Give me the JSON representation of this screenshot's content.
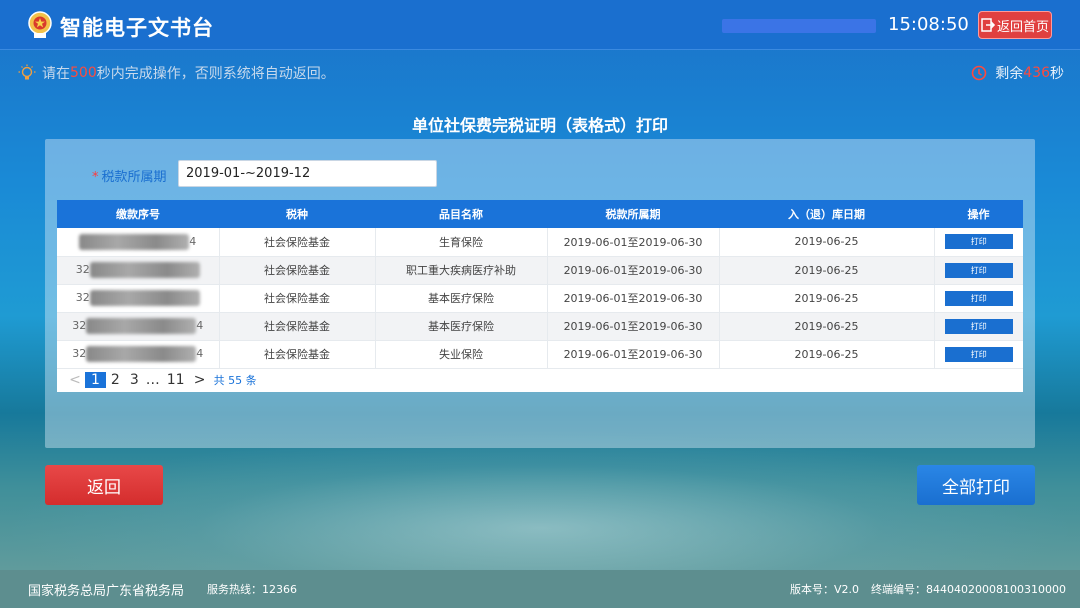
{
  "header": {
    "app_title": "智能电子文书台",
    "clock": "15:08:50",
    "home_button": "返回首页"
  },
  "notice": {
    "pre": "请在",
    "seconds": "500",
    "post": "秒内完成操作，否则系统将自动返回。"
  },
  "countdown": {
    "pre": "剩余",
    "seconds": "436",
    "post": "秒"
  },
  "page_title": "单位社保费完税证明（表格式）打印",
  "filter": {
    "required_mark": "*",
    "label": "税款所属期",
    "value": "2019-01-~2019-12"
  },
  "table": {
    "headers": [
      "缴款序号",
      "税种",
      "品目名称",
      "税款所属期",
      "入（退）库日期",
      "操作"
    ],
    "rows": [
      {
        "seq_prefix": "",
        "seq_suffix": "4",
        "tax_type": "社会保险基金",
        "item": "生育保险",
        "period": "2019-06-01至2019-06-30",
        "date": "2019-06-25",
        "action": "打印"
      },
      {
        "seq_prefix": "32",
        "seq_suffix": "",
        "tax_type": "社会保险基金",
        "item": "职工重大疾病医疗补助",
        "period": "2019-06-01至2019-06-30",
        "date": "2019-06-25",
        "action": "打印"
      },
      {
        "seq_prefix": "32",
        "seq_suffix": "",
        "tax_type": "社会保险基金",
        "item": "基本医疗保险",
        "period": "2019-06-01至2019-06-30",
        "date": "2019-06-25",
        "action": "打印"
      },
      {
        "seq_prefix": "32",
        "seq_suffix": "4",
        "tax_type": "社会保险基金",
        "item": "基本医疗保险",
        "period": "2019-06-01至2019-06-30",
        "date": "2019-06-25",
        "action": "打印"
      },
      {
        "seq_prefix": "32",
        "seq_suffix": "4",
        "tax_type": "社会保险基金",
        "item": "失业保险",
        "period": "2019-06-01至2019-06-30",
        "date": "2019-06-25",
        "action": "打印"
      }
    ]
  },
  "pagination": {
    "prev": "<",
    "pages": [
      "1",
      "2",
      "3"
    ],
    "ellipsis": "…",
    "last": "11",
    "next": ">",
    "total": "共 55 条"
  },
  "buttons": {
    "back": "返回",
    "print_all": "全部打印"
  },
  "footer": {
    "org": "国家税务总局广东省税务局",
    "hotline": "服务热线：12366",
    "version": "版本号：V2.0",
    "terminal": "终端编号：84404020008100310000"
  },
  "colors": {
    "header_bg": "#1a6fcf",
    "accent": "#1a73d9",
    "danger": "#e04040",
    "highlight": "#ff4a3d"
  }
}
